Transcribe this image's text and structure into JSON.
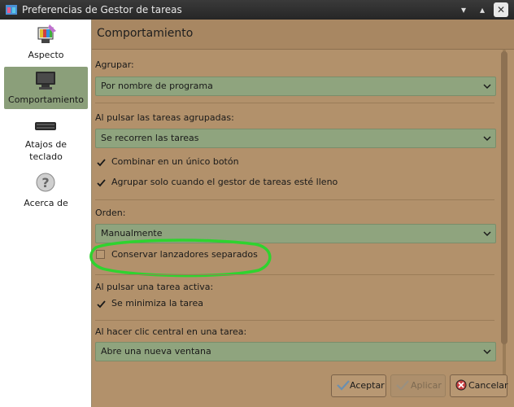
{
  "window": {
    "title": "Preferencias de Gestor de tareas"
  },
  "sidebar": {
    "items": [
      {
        "label": "Aspecto"
      },
      {
        "label": "Comportamiento"
      },
      {
        "label": "Atajos de\nteclado"
      },
      {
        "label": "Acerca de"
      }
    ],
    "selected": "Comportamiento"
  },
  "page": {
    "title": "Comportamiento"
  },
  "group": {
    "label": "Agrupar:",
    "value": "Por nombre de programa"
  },
  "grouped_click": {
    "label": "Al pulsar las tareas agrupadas:",
    "value": "Se recorren las tareas",
    "options": [
      {
        "label": "Combinar en un único botón",
        "checked": true
      },
      {
        "label": "Agrupar solo cuando el gestor de tareas esté lleno",
        "checked": true
      }
    ]
  },
  "order": {
    "label": "Orden:",
    "value": "Manualmente",
    "keep_launchers": {
      "label": "Conservar lanzadores separados",
      "checked": false
    }
  },
  "active_click": {
    "label": "Al pulsar una tarea activa:",
    "minimize": {
      "label": "Se minimiza la tarea",
      "checked": true
    }
  },
  "middle_click": {
    "label": "Al hacer clic central en una tarea:",
    "value": "Abre una nueva ventana"
  },
  "buttons": {
    "accept": "Aceptar",
    "apply": "Aplicar",
    "cancel": "Cancelar"
  },
  "colors": {
    "accent": "#8fa47e",
    "background": "#b2916b",
    "highlight_ring": "#2fd32f"
  }
}
